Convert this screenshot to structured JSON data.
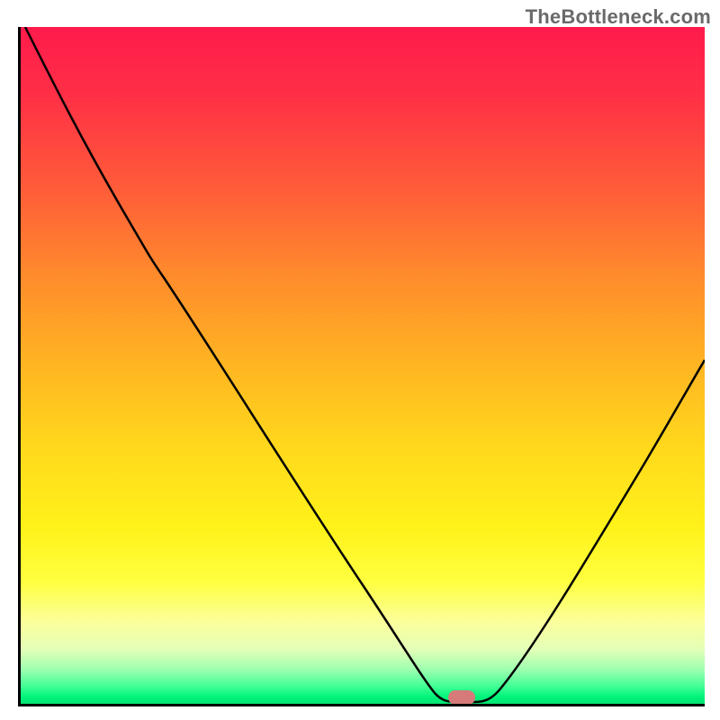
{
  "watermark": "TheBottleneck.com",
  "colors": {
    "axis": "#000000",
    "curve": "#000000",
    "marker": "#d67a7a",
    "gradient_top": "#ff1b4c",
    "gradient_bottom": "#00e472"
  },
  "chart_data": {
    "type": "line",
    "title": "",
    "xlabel": "",
    "ylabel": "",
    "xlim": [
      0,
      100
    ],
    "ylim": [
      0,
      100
    ],
    "x": [
      0,
      4,
      8,
      12,
      16,
      20,
      24,
      28,
      32,
      36,
      40,
      44,
      48,
      52,
      56,
      60,
      62,
      64,
      66,
      70,
      76,
      82,
      88,
      94,
      100
    ],
    "y": [
      100,
      94,
      87,
      80,
      73,
      67,
      59,
      51,
      43,
      36,
      29,
      22,
      16,
      10,
      5,
      1,
      0,
      0,
      0,
      4,
      12,
      22,
      33,
      44,
      56
    ],
    "marker": {
      "x": 64,
      "y": 0
    }
  }
}
